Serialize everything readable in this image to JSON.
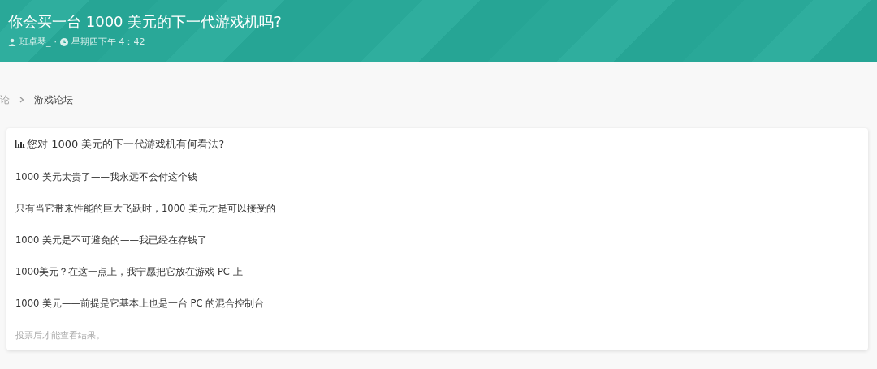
{
  "header": {
    "title": "你会买一台 1000 美元的下一代游戏机吗?",
    "author": "班卓琴_",
    "separator": "·",
    "time": "星期四下午 4：42"
  },
  "breadcrumb": [
    {
      "label": "论"
    },
    {
      "label": "游戏论坛"
    }
  ],
  "poll": {
    "question": "您对 1000 美元的下一代游戏机有何看法?",
    "options": [
      {
        "label": "1000 美元太贵了——我永远不会付这个钱"
      },
      {
        "label": "只有当它带来性能的巨大飞跃时，1000 美元才是可以接受的"
      },
      {
        "label": "1000 美元是不可避免的——我已经在存钱了"
      },
      {
        "label": "1000美元？在这一点上，我宁愿把它放在游戏 PC 上"
      },
      {
        "label": "1000 美元——前提是它基本上也是一台 PC 的混合控制台"
      }
    ],
    "footer": "投票后才能查看结果。"
  }
}
